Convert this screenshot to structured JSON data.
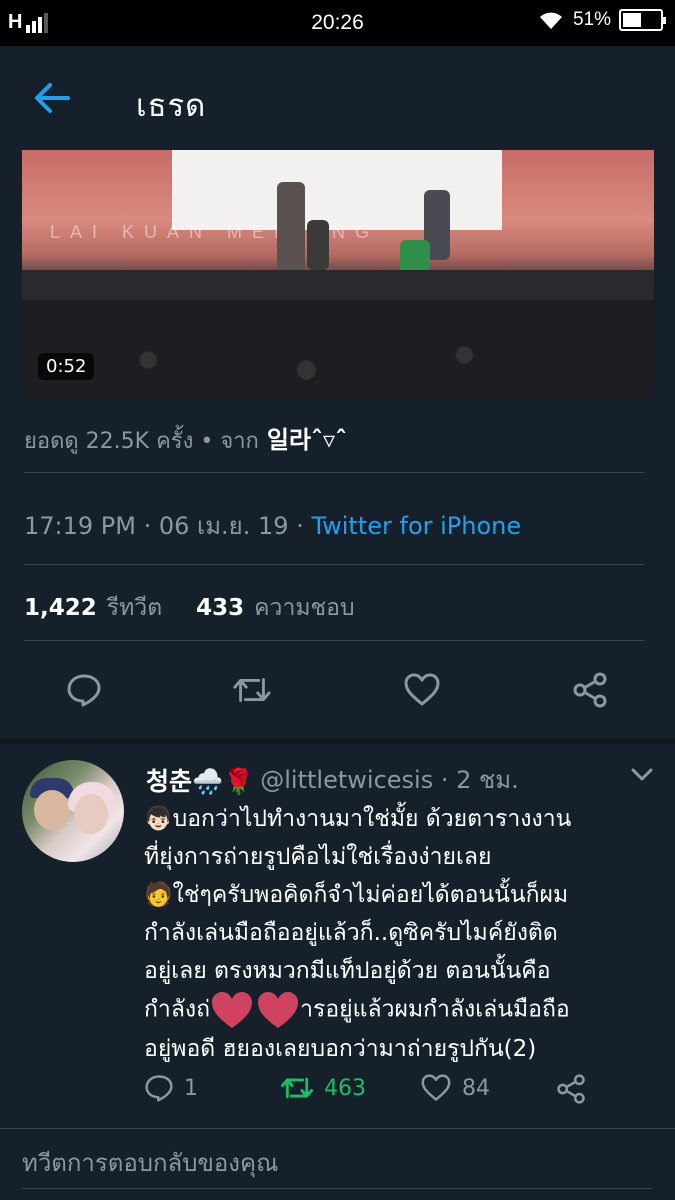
{
  "status_bar": {
    "network": "H",
    "time": "20:26",
    "battery_text": "51%",
    "battery_level": 0.51
  },
  "header": {
    "title": "เธรด"
  },
  "video": {
    "banner_text": "LAI KUAN  MEETING",
    "duration": "0:52"
  },
  "tweet": {
    "views_text": "ยอดดู 22.5K ครั้ง • จาก",
    "views_from": "일라ˆ▿ˆ",
    "time": "17:19 PM · 06 เม.ย. 19 · ",
    "source": "Twitter for iPhone",
    "retweets_count": "1,422",
    "retweets_label": "รีทวีต",
    "likes_count": "433",
    "likes_label": "ความชอบ"
  },
  "reply": {
    "display_name": "청춘🌧️🌹",
    "handle": "@littletwicesis · 2 ชม.",
    "lines": [
      "👦🏻บอกว่าไปทำงานมาใช่มั้ย ด้วยตารางงาน",
      "ที่ยุ่งการถ่ายรูปคือไม่ใช่เรื่องง่ายเลย",
      "🧑ใช่ๆครับพอคิดก็จำไม่ค่อยได้ตอนนั้นก็ผม",
      "กำลังเล่นมือถืออยู่แล้วก็..ดูซิครับไมค์ยังติด",
      "อยู่เลย ตรงหมวกมีแท็ปอยู่ด้วย ตอนนั้นคือ",
      "อยู่พอดี ฮยองเลยบอกว่ามาถ่ายรูปกัน(2)"
    ],
    "line6_start": "กำลังถ่",
    "line6_end": "ารอยู่แล้วผมกำลังเล่นมือถือ",
    "replies": "1",
    "retweets": "463",
    "likes": "84"
  },
  "compose": {
    "placeholder": "ทวีตการตอบกลับของคุณ"
  },
  "colors": {
    "background": "#15202b",
    "accent": "#1da1f2",
    "muted": "#8899a6",
    "retweet_green": "#17bf63",
    "heart_pink": "#f04a6a"
  }
}
